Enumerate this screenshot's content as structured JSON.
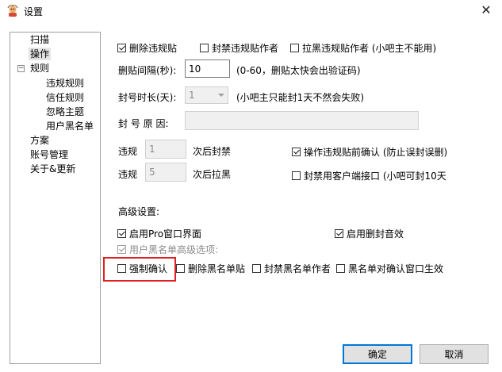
{
  "window": {
    "title": "设置",
    "close_glyph": "✕"
  },
  "tree": {
    "items": [
      {
        "label": "扫描"
      },
      {
        "label": "操作",
        "selected": true
      },
      {
        "label": "规则",
        "expander": "−"
      },
      {
        "label": "违规规则"
      },
      {
        "label": "信任规则"
      },
      {
        "label": "忽略主题"
      },
      {
        "label": "用户黑名单"
      },
      {
        "label": "方案"
      },
      {
        "label": "账号管理"
      },
      {
        "label": "关于&更新"
      }
    ]
  },
  "options": {
    "delete_post": {
      "label": "删除违规贴",
      "checked": true
    },
    "ban_author": {
      "label": "封禁违规贴作者",
      "checked": false
    },
    "blacklist_author": {
      "label": "拉黑违规贴作者 (小吧主不能用)",
      "checked": false
    },
    "interval": {
      "label": "删贴间隔(秒):",
      "value": "10",
      "hint": "(0-60，删贴太快会出验证码)"
    },
    "ban_duration": {
      "label": "封号时长(天):",
      "value": "1",
      "hint": "(小吧主只能封1天不然会失败)"
    },
    "ban_reason": {
      "label": "封 号 原 因:",
      "value": ""
    },
    "violation_ban": {
      "prefix": "违规",
      "value": "1",
      "suffix": "次后封禁"
    },
    "violation_blacklist": {
      "prefix": "违规",
      "value": "5",
      "suffix": "次后拉黑"
    },
    "confirm_before_action": {
      "label": "操作违规贴前确认 (防止误封误删)",
      "checked": true
    },
    "disable_client_api": {
      "label": "封禁用客户端接口 (小吧可封10天",
      "checked": false
    }
  },
  "advanced": {
    "heading": "高级设置:",
    "pro_ui": {
      "label": "启用Pro窗口界面",
      "checked": true
    },
    "delete_sound": {
      "label": "启用删封音效",
      "checked": true
    },
    "blacklist_advanced": {
      "label": "用户黑名单高级选项:",
      "checked": true
    },
    "force_confirm": {
      "label": "强制确认",
      "checked": false
    },
    "delete_blacklist_post": {
      "label": "删除黑名单贴",
      "checked": false
    },
    "ban_blacklist_author": {
      "label": "封禁黑名单作者",
      "checked": false
    },
    "blacklist_confirm_window": {
      "label": "黑名单对确认窗口生效",
      "checked": false
    }
  },
  "buttons": {
    "ok": "确定",
    "cancel": "取消"
  },
  "colors": {
    "highlight": "#e02020",
    "default_button_border": "#0078d7"
  }
}
